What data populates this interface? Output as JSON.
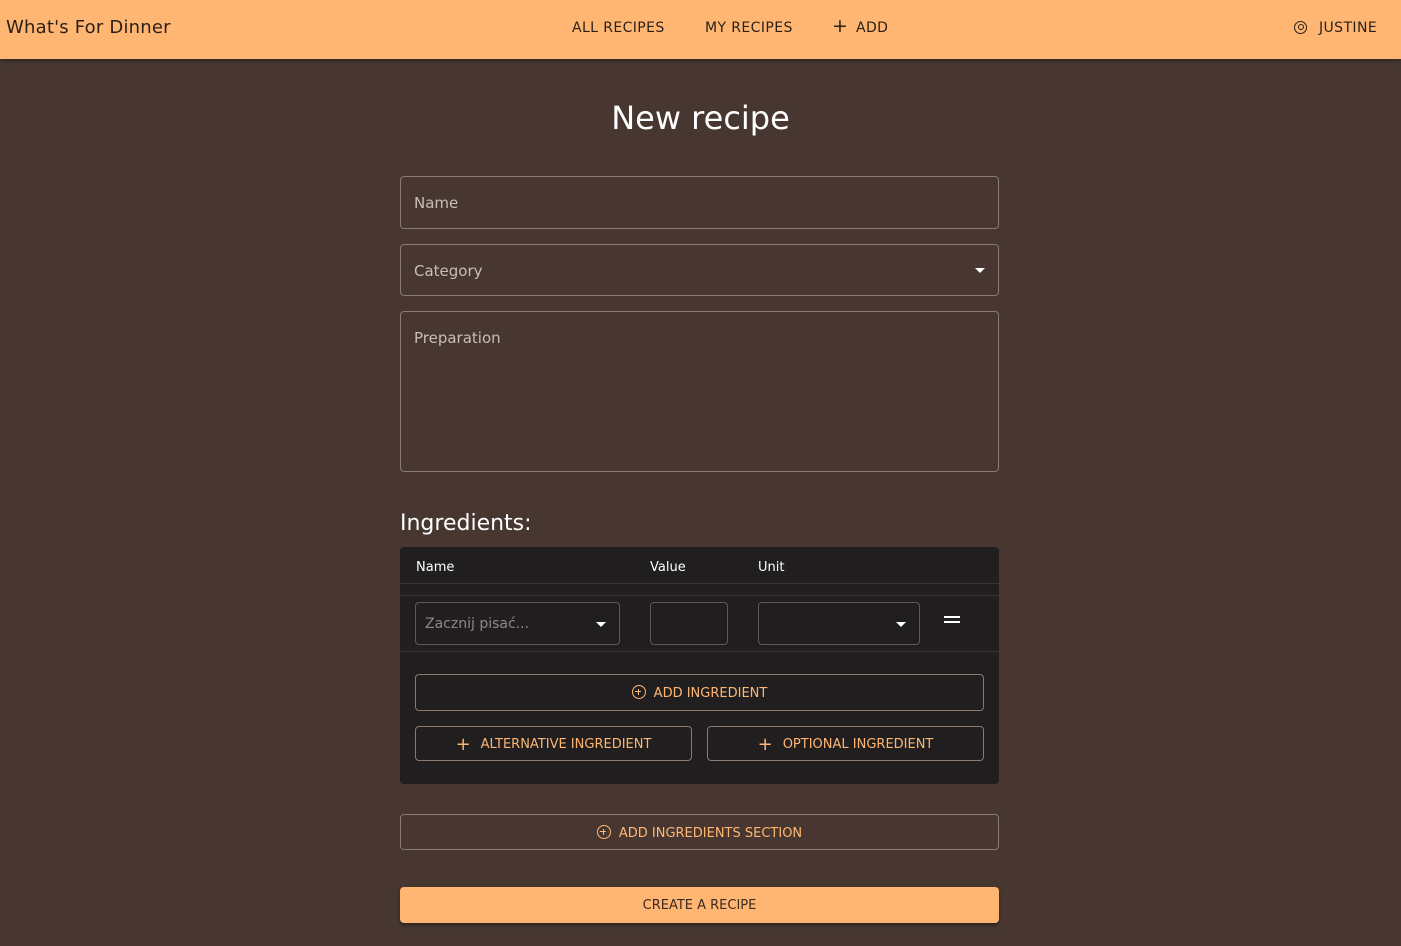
{
  "app": {
    "brand": "What's For Dinner"
  },
  "nav": {
    "all_recipes": "ALL RECIPES",
    "my_recipes": "MY RECIPES",
    "add": "ADD",
    "user": "JUSTINE"
  },
  "page": {
    "title": "New recipe"
  },
  "form": {
    "name_label": "Name",
    "category_label": "Category",
    "preparation_label": "Preparation"
  },
  "ingredients": {
    "title": "Ingredients:",
    "col_name": "Name",
    "col_value": "Value",
    "col_unit": "Unit",
    "name_placeholder": "Zacznij pisać...",
    "add_ingredient": "ADD INGREDIENT",
    "alternative_ingredient": "ALTERNATIVE INGREDIENT",
    "optional_ingredient": "OPTIONAL INGREDIENT"
  },
  "actions": {
    "add_section": "ADD INGREDIENTS SECTION",
    "create": "CREATE A RECIPE"
  },
  "colors": {
    "accent": "#ffb672",
    "background": "#473730",
    "panel": "#201e1e"
  }
}
